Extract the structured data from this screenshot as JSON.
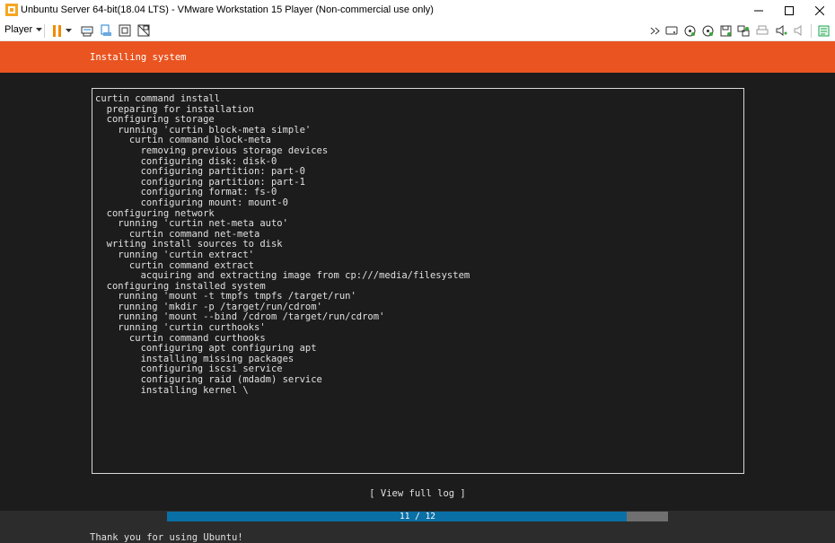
{
  "window": {
    "title": "Unbuntu Server 64-bit(18.04 LTS) - VMware Workstation 15 Player (Non-commercial use only)"
  },
  "toolbar": {
    "player_label": "Player",
    "icons": [
      "pause-icon",
      "send-ctrl-alt-del-icon",
      "removable-devices-icon",
      "fullscreen-icon",
      "unity-icon"
    ],
    "right_icons": [
      "chevron-right-icon",
      "hard-disk-icon",
      "cd-dvd-icon",
      "cd-dvd-2-icon",
      "floppy-icon",
      "network-icon",
      "printer-icon",
      "sound-icon",
      "speaker-icon",
      "message-log-icon"
    ]
  },
  "installer": {
    "header": "Installing system",
    "log_lines": [
      "curtin command install",
      "  preparing for installation",
      "  configuring storage",
      "    running 'curtin block-meta simple'",
      "      curtin command block-meta",
      "        removing previous storage devices",
      "        configuring disk: disk-0",
      "        configuring partition: part-0",
      "        configuring partition: part-1",
      "        configuring format: fs-0",
      "        configuring mount: mount-0",
      "  configuring network",
      "    running 'curtin net-meta auto'",
      "      curtin command net-meta",
      "  writing install sources to disk",
      "    running 'curtin extract'",
      "      curtin command extract",
      "        acquiring and extracting image from cp:///media/filesystem",
      "  configuring installed system",
      "    running 'mount -t tmpfs tmpfs /target/run'",
      "    running 'mkdir -p /target/run/cdrom'",
      "    running 'mount --bind /cdrom /target/run/cdrom'",
      "    running 'curtin curthooks'",
      "      curtin command curthooks",
      "        configuring apt configuring apt",
      "        installing missing packages",
      "        configuring iscsi service",
      "        configuring raid (mdadm) service",
      "        installing kernel \\"
    ],
    "view_full_log": "[ View full log ]",
    "progress": {
      "current": 11,
      "total": 12,
      "label": "11 / 12"
    },
    "footer": "Thank you for using Ubuntu!"
  },
  "colors": {
    "ubuntu_orange": "#e95420",
    "progress_fill": "#0a6fa5",
    "progress_track": "#707070",
    "terminal_bg": "#1c1c1c"
  }
}
